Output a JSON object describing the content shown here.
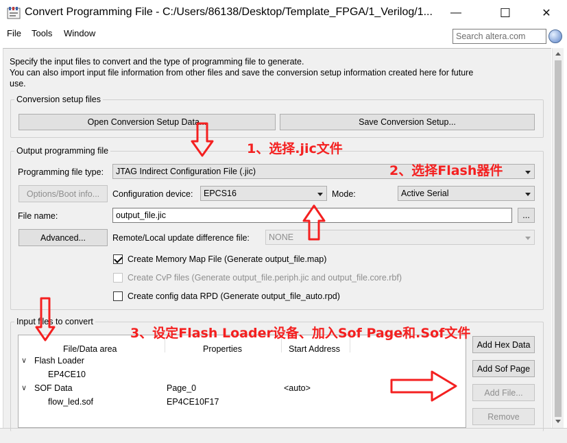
{
  "window": {
    "title": "Convert Programming File - C:/Users/86138/Desktop/Template_FPGA/1_Verilog/1...",
    "minimize_glyph": "—",
    "maximize_glyph": "☐",
    "close_glyph": "✕"
  },
  "menu": {
    "items": [
      "File",
      "Tools",
      "Window"
    ],
    "search_placeholder": "Search altera.com"
  },
  "description": "Specify the input files to convert and the type of programming file to generate.\nYou can also import input file information from other files and save the conversion setup information created here for future use.",
  "setup_group": {
    "title": "Conversion setup files",
    "open_button": "Open Conversion Setup Data...",
    "save_button": "Save Conversion Setup..."
  },
  "output_group": {
    "title": "Output programming file",
    "programming_type_label": "Programming file type:",
    "programming_type_value": "JTAG Indirect Configuration File (.jic)",
    "options_button": "Options/Boot info...",
    "config_device_label": "Configuration device:",
    "config_device_value": "EPCS16",
    "mode_label": "Mode:",
    "mode_value": "Active Serial",
    "file_name_label": "File name:",
    "file_name_value": "output_file.jic",
    "browse_button": "...",
    "advanced_button": "Advanced...",
    "remote_label": "Remote/Local update difference file:",
    "remote_value": "NONE",
    "checkboxes": [
      {
        "label": "Create Memory Map File (Generate output_file.map)",
        "checked": true,
        "enabled": true
      },
      {
        "label": "Create CvP files (Generate output_file.periph.jic and output_file.core.rbf)",
        "checked": false,
        "enabled": false
      },
      {
        "label": "Create config data RPD (Generate output_file_auto.rpd)",
        "checked": false,
        "enabled": true
      }
    ]
  },
  "input_group": {
    "title": "Input files to convert",
    "columns": [
      "File/Data area",
      "Properties",
      "Start Address"
    ],
    "rows": [
      {
        "name": "Flash Loader",
        "properties": "",
        "start": ""
      },
      {
        "name": "EP4CE10",
        "properties": "",
        "start": ""
      },
      {
        "name": "SOF Data",
        "properties": "Page_0",
        "start": "<auto>"
      },
      {
        "name": "flow_led.sof",
        "properties": "EP4CE10F17",
        "start": ""
      }
    ],
    "buttons": {
      "add_hex": "Add Hex Data",
      "add_sof_page": "Add Sof Page",
      "add_file": "Add File...",
      "remove": "Remove"
    }
  },
  "annotations": {
    "step1": "1、选择.jic文件",
    "step2": "2、选择Flash器件",
    "step3": "3、设定Flash Loader设备、加入Sof Page和.Sof文件",
    "color": "#f42020"
  }
}
